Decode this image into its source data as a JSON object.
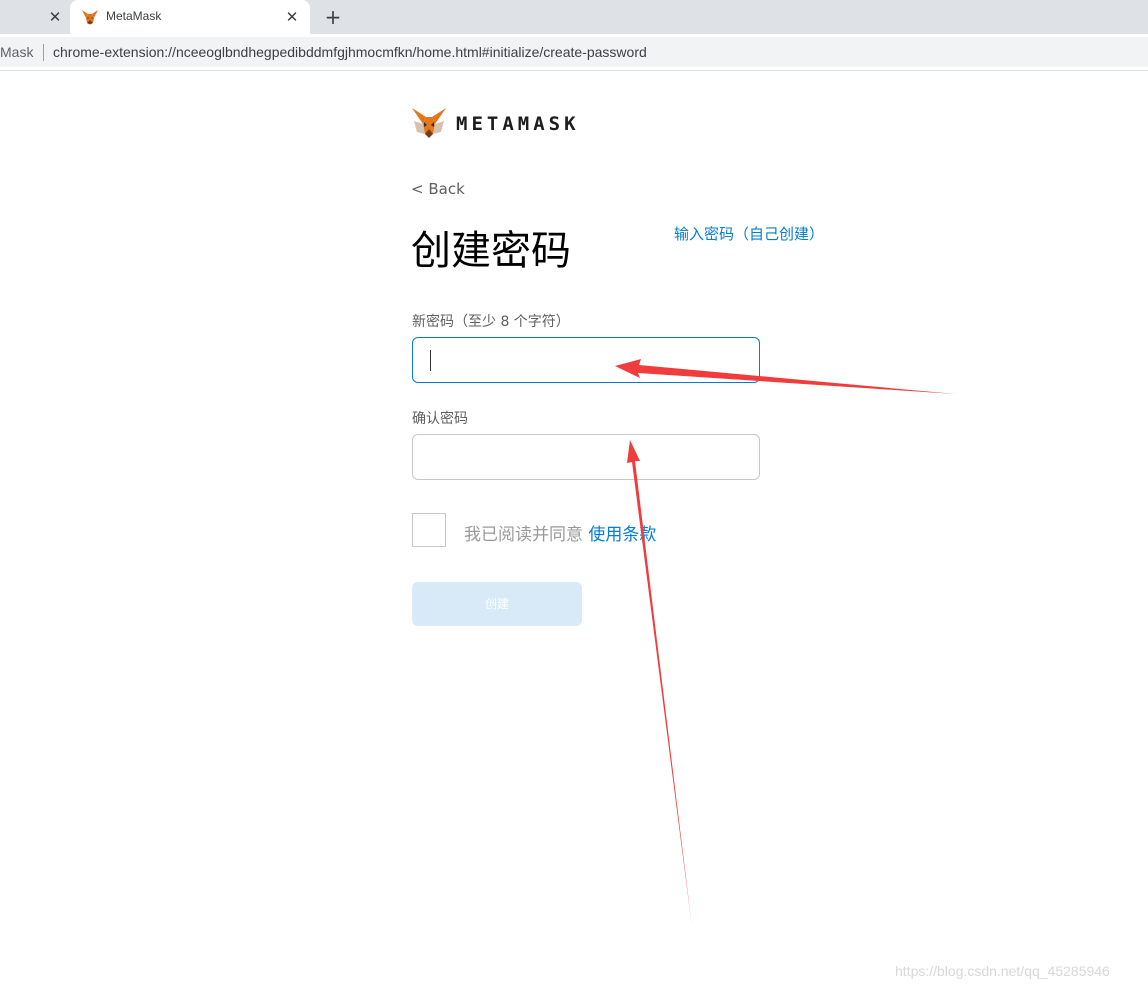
{
  "browser": {
    "active_tab_title": "MetaMask",
    "address_origin": "Mask",
    "address_url": "chrome-extension://nceeoglbndhegpedibddmfgjhmocmfkn/home.html#initialize/create-password"
  },
  "brand": {
    "wordmark": "METAMASK",
    "accent_color": "#037dd6",
    "fox_color": "#e2761b"
  },
  "page": {
    "back_label": "< Back",
    "title": "创建密码",
    "import_link": "输入密码（自己创建）"
  },
  "form": {
    "new_password_label": "新密码（至少 8 个字符）",
    "new_password_value": "",
    "confirm_password_label": "确认密码",
    "confirm_password_value": "",
    "checkbox_checked": false,
    "agree_text": "我已阅读并同意 ",
    "terms_link": "使用条款",
    "create_button": "创建"
  },
  "annotation": {
    "arrow_color": "#f03c3c"
  },
  "watermark": "https://blog.csdn.net/qq_45285946"
}
